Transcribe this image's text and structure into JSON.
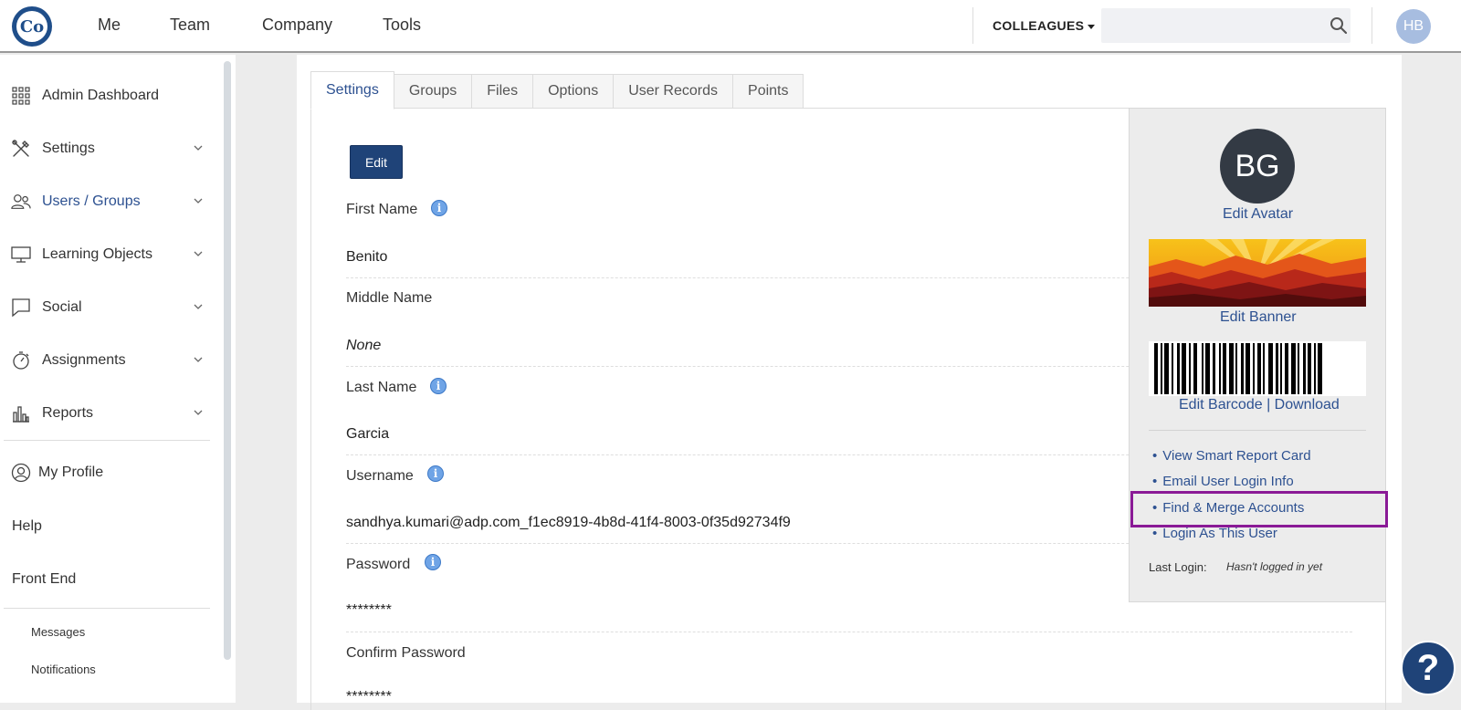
{
  "nav": {
    "items": [
      {
        "label": "Me"
      },
      {
        "label": "Team"
      },
      {
        "label": "Company"
      },
      {
        "label": "Tools"
      }
    ],
    "colleagues_label": "COLLEAGUES",
    "search": {
      "value": "",
      "placeholder": ""
    },
    "user_initials": "HB",
    "logo_text": "Co"
  },
  "sidebar": {
    "items": [
      {
        "label": "Admin Dashboard",
        "icon": "grid-icon"
      },
      {
        "label": "Settings",
        "icon": "tools-icon"
      },
      {
        "label": "Users / Groups",
        "icon": "users-icon"
      },
      {
        "label": "Learning Objects",
        "icon": "monitor-icon"
      },
      {
        "label": "Social",
        "icon": "chat-icon"
      },
      {
        "label": "Assignments",
        "icon": "stopwatch-icon"
      },
      {
        "label": "Reports",
        "icon": "bar-chart-icon"
      }
    ],
    "my_profile": "My Profile",
    "help": "Help",
    "front_end": "Front End",
    "messages": "Messages",
    "notifications": "Notifications"
  },
  "tabs": [
    {
      "label": "Settings"
    },
    {
      "label": "Groups"
    },
    {
      "label": "Files"
    },
    {
      "label": "Options"
    },
    {
      "label": "User Records"
    },
    {
      "label": "Points"
    }
  ],
  "form": {
    "edit_label": "Edit",
    "fields": [
      {
        "label": "First Name",
        "value": "Benito"
      },
      {
        "label": "Middle Name",
        "value": "None"
      },
      {
        "label": "Last Name",
        "value": "Garcia"
      },
      {
        "label": "Username",
        "value": "sandhya.kumari@adp.com_f1ec8919-4b8d-41f4-8003-0f35d92734f9"
      },
      {
        "label": "Password",
        "value": "********"
      },
      {
        "label": "Confirm Password",
        "value": "********"
      }
    ],
    "info_glyph": "i"
  },
  "profile_card": {
    "avatar_initials": "BG",
    "edit_avatar": "Edit Avatar",
    "edit_banner": "Edit Banner",
    "edit_barcode": "Edit Barcode",
    "barcode_sep": "|",
    "download": "Download",
    "links": [
      {
        "label": "View Smart Report Card"
      },
      {
        "label": "Email User Login Info"
      },
      {
        "label": "Find & Merge Accounts"
      },
      {
        "label": "Login As This User"
      }
    ],
    "last_login_label": "Last Login:",
    "last_login_value": "Hasn't logged in yet"
  },
  "help_button": "?",
  "colors": {
    "brand_blue": "#1f4378",
    "link_blue": "#2d5191",
    "highlight": "#8a1a96"
  }
}
